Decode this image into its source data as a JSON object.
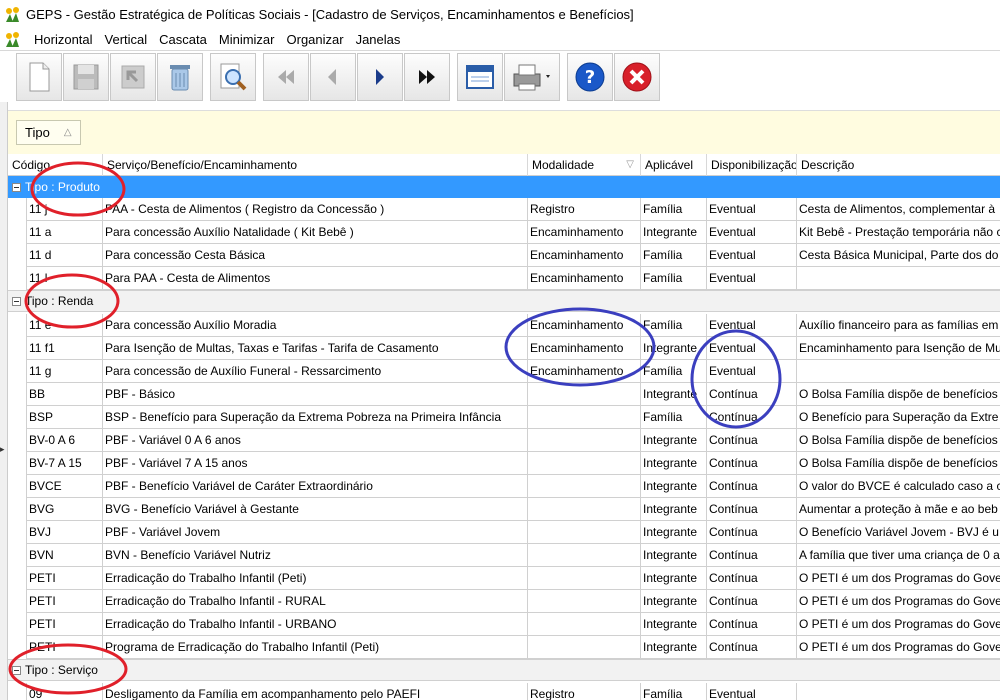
{
  "window": {
    "title": "GEPS - Gestão Estratégica de Políticas Sociais - [Cadastro de Serviços, Encaminhamentos e Benefícios]"
  },
  "menu": [
    "Horizontal",
    "Vertical",
    "Cascata",
    "Minimizar",
    "Organizar",
    "Janelas"
  ],
  "toolbar": {
    "buttons": [
      "new-document-icon",
      "save-icon",
      "undo-icon",
      "trash-icon",
      "search-icon",
      "first-record-icon",
      "previous-record-icon",
      "next-record-icon",
      "last-record-icon",
      "window-icon",
      "print-icon",
      "help-icon",
      "close-icon"
    ]
  },
  "groupbar": {
    "chip": "Tipo"
  },
  "columns": [
    "Código",
    "Serviço/Benefício/Encaminhamento",
    "Modalidade",
    "Aplicável",
    "Disponibilização",
    "Descrição"
  ],
  "groups": [
    {
      "label": "Tipo : Produto",
      "rows": [
        [
          "11 j",
          "PAA - Cesta de Alimentos ( Registro da Concessão )",
          "Registro",
          "Família",
          "Eventual",
          "Cesta de Alimentos, complementar à"
        ],
        [
          "11 a",
          "Para concessão Auxílio Natalidade ( Kit Bebê )",
          "Encaminhamento",
          "Integrante",
          "Eventual",
          "Kit Bebê - Prestação temporária não c"
        ],
        [
          "11 d",
          "Para concessão Cesta Básica",
          "Encaminhamento",
          "Família",
          "Eventual",
          "Cesta Básica Municipal, Parte dos do"
        ],
        [
          "11 l",
          "Para PAA - Cesta de Alimentos",
          "Encaminhamento",
          "Família",
          "Eventual",
          ""
        ]
      ]
    },
    {
      "label": "Tipo : Renda",
      "rows": [
        [
          "11 e",
          "Para concessão Auxílio Moradia",
          "Encaminhamento",
          "Família",
          "Eventual",
          "Auxílio financeiro para as famílias em"
        ],
        [
          "11 f1",
          "Para Isenção de Multas, Taxas e Tarifas - Tarifa de Casamento",
          "Encaminhamento",
          "Integrante",
          "Eventual",
          "Encaminhamento para Isenção de Mu"
        ],
        [
          "11 g",
          "Para concessão de Auxílio Funeral - Ressarcimento",
          "Encaminhamento",
          "Família",
          "Eventual",
          ""
        ],
        [
          "BB",
          "PBF - Básico",
          "",
          "Integrante",
          "Contínua",
          "O Bolsa Família dispõe de benefícios f"
        ],
        [
          "BSP",
          "BSP - Benefício para Superação da Extrema Pobreza na Primeira Infância",
          "",
          "Família",
          "Contínua",
          "O Benefício para Superação da Extre"
        ],
        [
          "BV-0 A 6",
          "PBF - Variável 0 A 6 anos",
          "",
          "Integrante",
          "Contínua",
          "O Bolsa Família dispõe de benefícios f"
        ],
        [
          "BV-7 A 15",
          "PBF - Variável 7 A 15  anos",
          "",
          "Integrante",
          "Contínua",
          "O Bolsa Família dispõe de benefícios f"
        ],
        [
          "BVCE",
          "PBF - Benefício Variável de Caráter Extraordinário",
          "",
          "Integrante",
          "Contínua",
          " O valor do BVCE é calculado caso a c"
        ],
        [
          "BVG",
          "BVG - Benefício Variável à Gestante",
          "",
          "Integrante",
          "Contínua",
          "Aumentar a proteção à mãe e ao beb"
        ],
        [
          "BVJ",
          "PBF - Variável Jovem",
          "",
          "Integrante",
          "Contínua",
          "O Benefício Variável Jovem - BVJ é u"
        ],
        [
          "BVN",
          "BVN - Benefício Variável Nutriz",
          "",
          "Integrante",
          "Contínua",
          "A família que tiver uma criança de 0 a"
        ],
        [
          "PETI",
          "Erradicação do Trabalho Infantil (Peti)",
          "",
          "Integrante",
          "Contínua",
          "O PETI é um dos Programas do Gover"
        ],
        [
          "PETI",
          "Erradicação do Trabalho Infantil - RURAL",
          "",
          "Integrante",
          "Contínua",
          "O PETI é um dos Programas do Gover"
        ],
        [
          "PETI",
          "Erradicação do Trabalho Infantil - URBANO",
          "",
          "Integrante",
          "Contínua",
          "O PETI é um dos Programas do Gover"
        ],
        [
          "PETI",
          "Programa de Erradicação do Trabalho Infantil (Peti)",
          "",
          "Integrante",
          "Contínua",
          "O PETI é um dos Programas do Gover"
        ]
      ]
    },
    {
      "label": "Tipo : Serviço",
      "rows": [
        [
          "09",
          "Desligamento da Família em acompanhamento pelo PAEFI",
          "Registro",
          "Família",
          "Eventual",
          ""
        ]
      ]
    }
  ],
  "colors": {
    "selected_group": "#3399ff",
    "groupbar_bg": "#fffce0",
    "annotation_red": "#e0202a",
    "annotation_blue": "#3b3fbf"
  }
}
